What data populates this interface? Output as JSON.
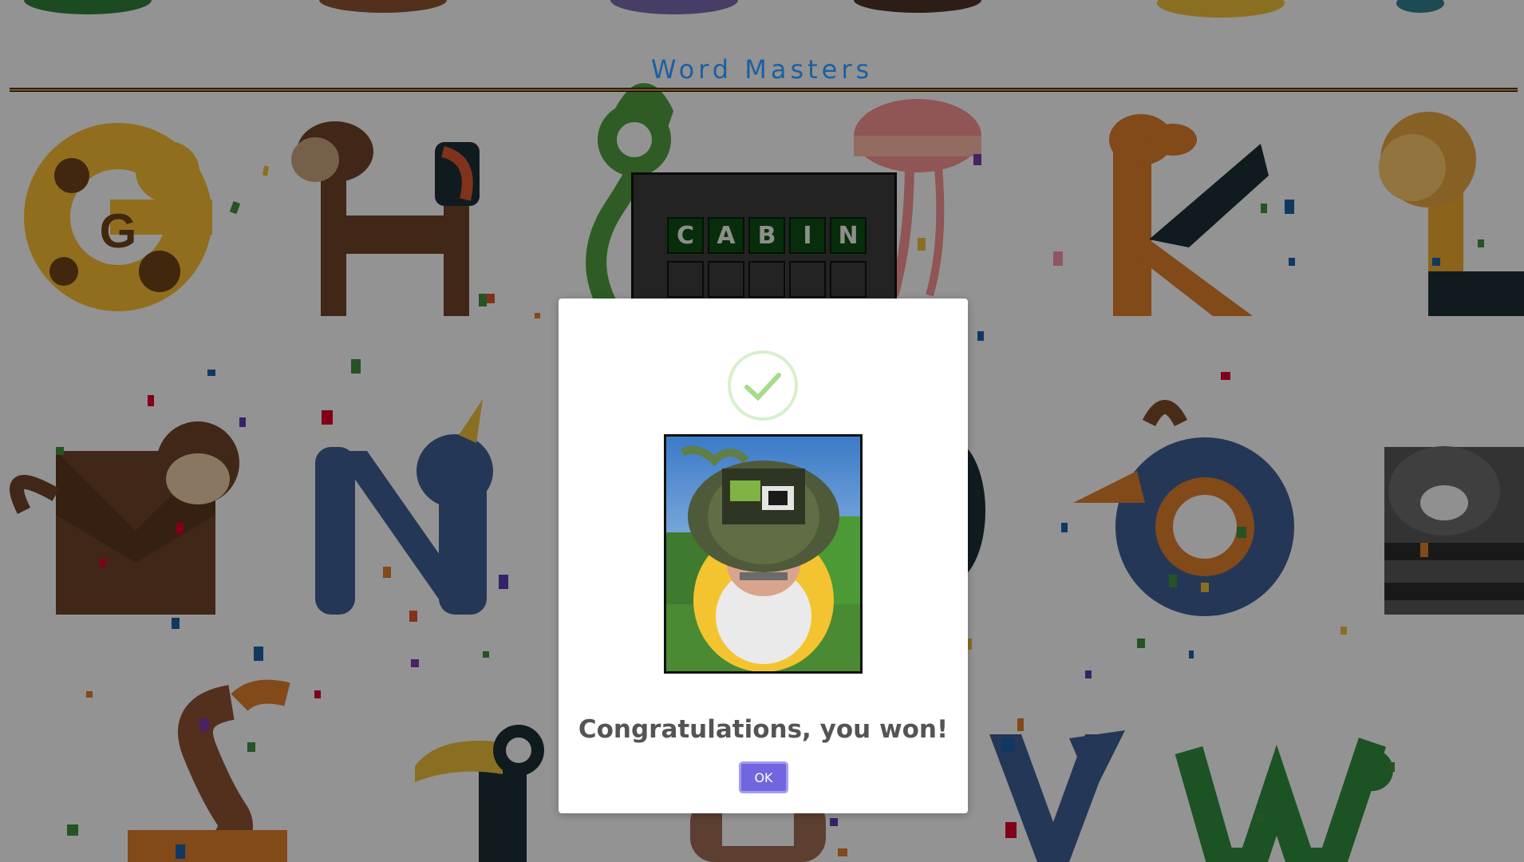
{
  "header": {
    "title": "Word Masters"
  },
  "board": {
    "rows": [
      [
        "C",
        "A",
        "B",
        "I",
        "N"
      ],
      [
        "",
        "",
        "",
        "",
        ""
      ]
    ]
  },
  "background": {
    "letters": [
      "G",
      "H",
      "I",
      "J",
      "K",
      "L",
      "M",
      "N",
      "O",
      "P",
      "Q",
      "R",
      "S",
      "T",
      "U",
      "V",
      "W"
    ]
  },
  "dialog": {
    "icon": "success-check-icon",
    "message": "Congratulations, you won!",
    "ok_label": "OK"
  },
  "colors": {
    "title": "#1b5fa4",
    "tile_correct": "#0d4b12",
    "ok_button": "#7066e0",
    "success_check": "#a5dc86"
  }
}
